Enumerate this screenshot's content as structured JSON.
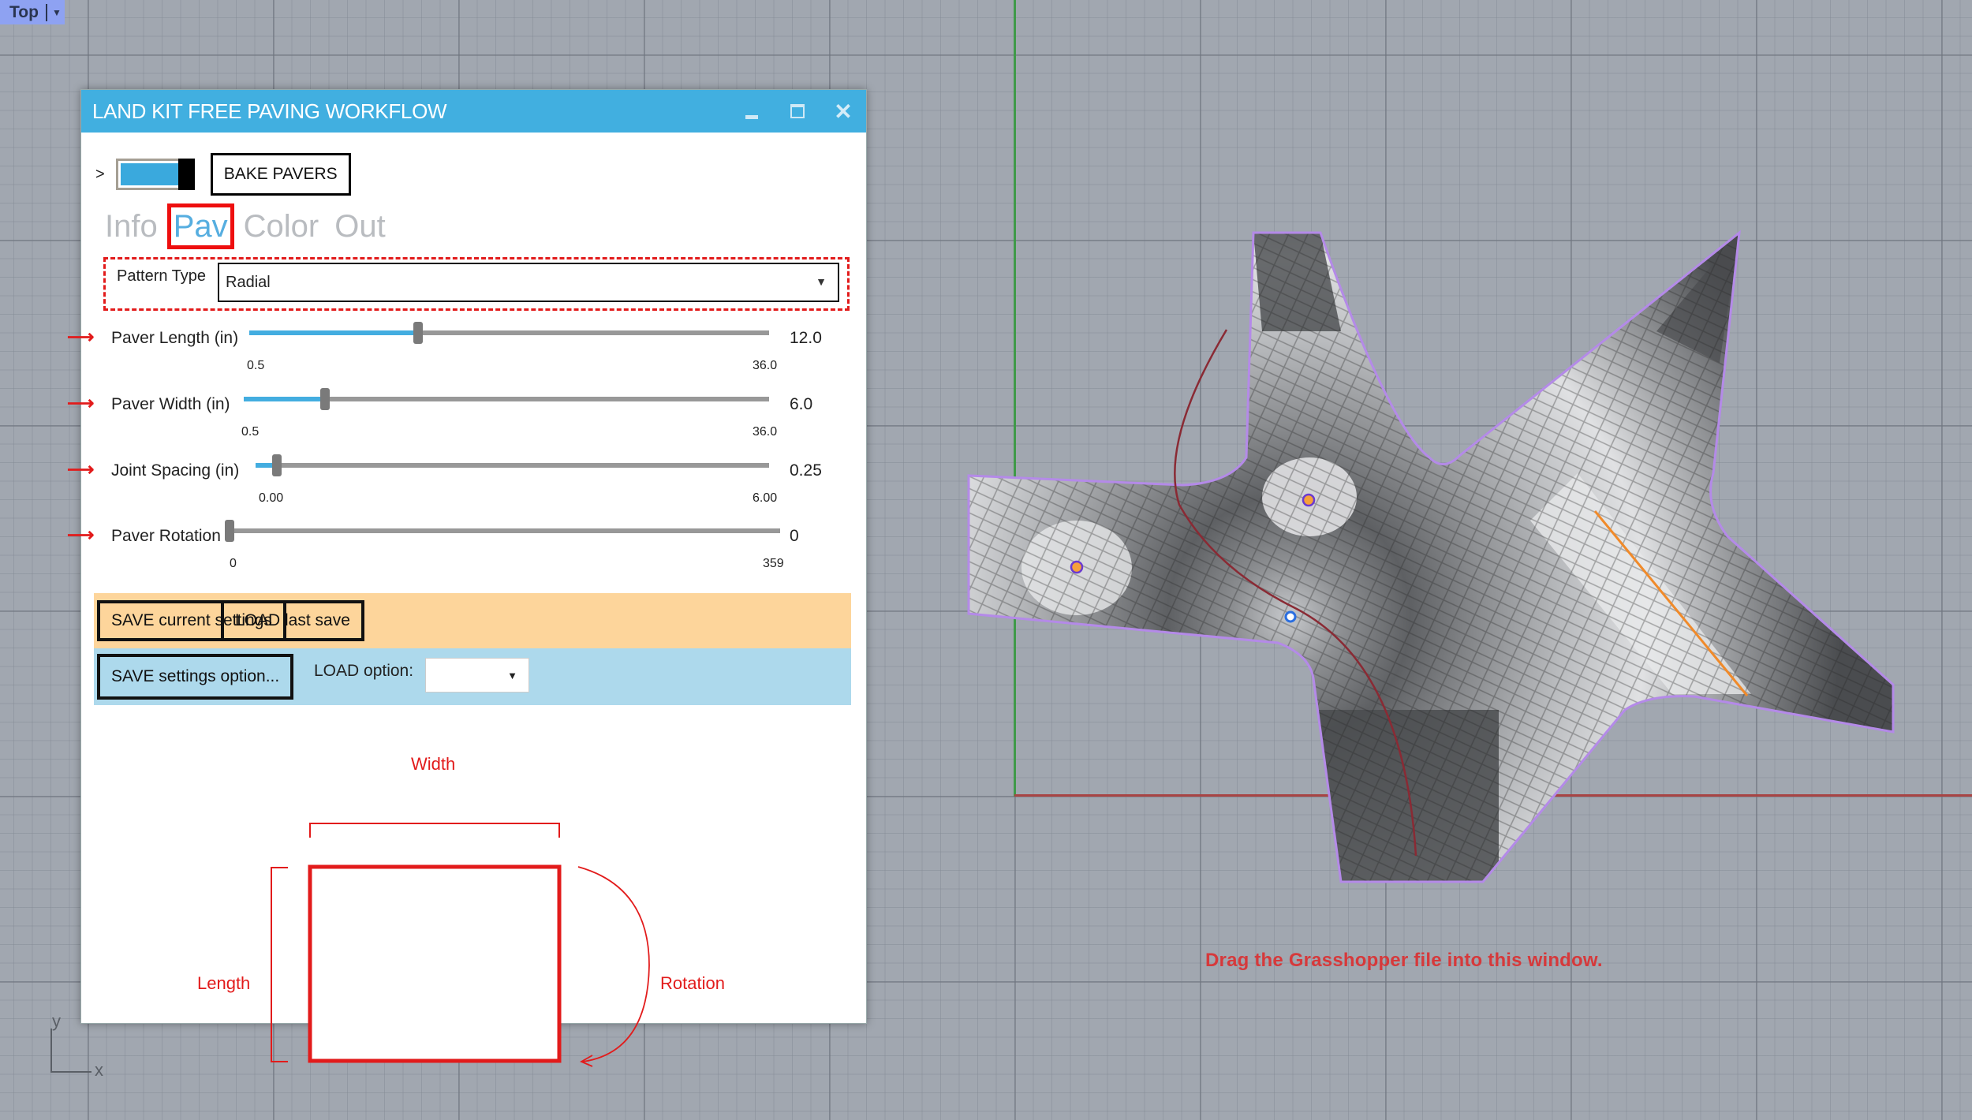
{
  "viewport": {
    "tab_label": "Top",
    "hint_text": "Drag the Grasshopper file into this window.",
    "axis_labels": {
      "x": "x",
      "y": "y"
    },
    "colors": {
      "x_axis": "#a84444",
      "y_axis": "#3f9a48",
      "background": "#a1a7b0",
      "outline": "#b48ae8",
      "orange_line": "#f08a2a",
      "curve": "#8a2a34"
    }
  },
  "dialog": {
    "title": "LAND KIT FREE PAVING WORKFLOW",
    "chevron": ">",
    "toggle_on": true,
    "bake_button": "BAKE PAVERS",
    "tabs": [
      {
        "label": "Info",
        "active": false
      },
      {
        "label": "Pav",
        "active": true
      },
      {
        "label": "Color",
        "active": false
      },
      {
        "label": "Out",
        "active": false
      }
    ],
    "pattern_type": {
      "label": "Pattern Type",
      "value": "Radial"
    },
    "sliders": [
      {
        "name": "Paver Length (in)",
        "min": "0.5",
        "max": "36.0",
        "value": "12.0",
        "fraction": 0.324
      },
      {
        "name": "Paver Width (in)",
        "min": "0.5",
        "max": "36.0",
        "value": "6.0",
        "fraction": 0.155
      },
      {
        "name": "Joint Spacing (in)",
        "min": "0.00",
        "max": "6.00",
        "value": "0.25",
        "fraction": 0.042
      },
      {
        "name": "Paver Rotation",
        "min": "0",
        "max": "359",
        "value": "0",
        "fraction": 0.0
      }
    ],
    "save_current": "SAVE current settings",
    "load_last": "LOAD last save",
    "save_option": "SAVE settings option...",
    "load_option_label": "LOAD option:",
    "load_option_value": "",
    "diagram": {
      "width": "Width",
      "length": "Length",
      "rotation": "Rotation"
    },
    "colors": {
      "titlebar": "#41afe0",
      "accent": "#e21b1b",
      "save_band": "#fdd59b",
      "load_band": "#add9ec"
    }
  }
}
